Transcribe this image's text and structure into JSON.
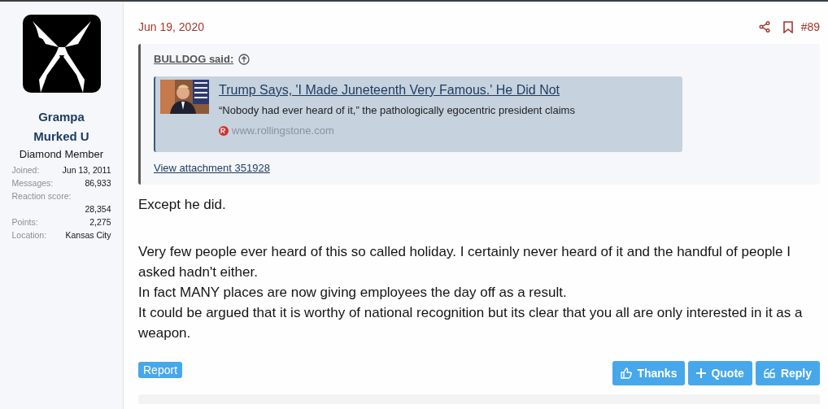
{
  "user": {
    "name": "Grampa Murked U",
    "title": "Diamond Member",
    "stats": [
      {
        "label": "Joined:",
        "value": "Jun 13, 2011",
        "kind": "inline"
      },
      {
        "label": "Messages:",
        "value": "86,933",
        "kind": "inline"
      },
      {
        "label": "Reaction score:",
        "value": "28,354",
        "kind": "stacked"
      },
      {
        "label": "Points:",
        "value": "2,275",
        "kind": "inline"
      },
      {
        "label": "Location:",
        "value": "Kansas City",
        "kind": "inline"
      }
    ]
  },
  "post": {
    "date": "Jun 19, 2020",
    "number": "#89",
    "quote": {
      "author": "BULLDOG said:",
      "embed": {
        "kind": "picture",
        "title": "Trump Says, 'I Made Juneteenth Very Famous.' He Did Not",
        "description": "“Nobody had ever heard of it,” the pathologically egocentric president claims",
        "site": "www.rollingstone.com"
      },
      "attachment": "View attachment 351928"
    },
    "body": [
      {
        "text": "Except he did."
      },
      {
        "text": "Very few people ever heard of this so called holiday. I certainly never heard of it and the handful of people I asked hadn't either."
      },
      {
        "text": "In fact MANY places are now giving employees the day off as a result."
      },
      {
        "text": "It could be argued that it is worthy of national recognition but its clear that you all are only interested in it as a weapon."
      }
    ],
    "report": "Report",
    "actions": [
      {
        "kind": "thanks",
        "label": "Thanks"
      },
      {
        "kind": "quote",
        "label": "Quote"
      },
      {
        "kind": "reply",
        "label": "Reply"
      }
    ]
  }
}
